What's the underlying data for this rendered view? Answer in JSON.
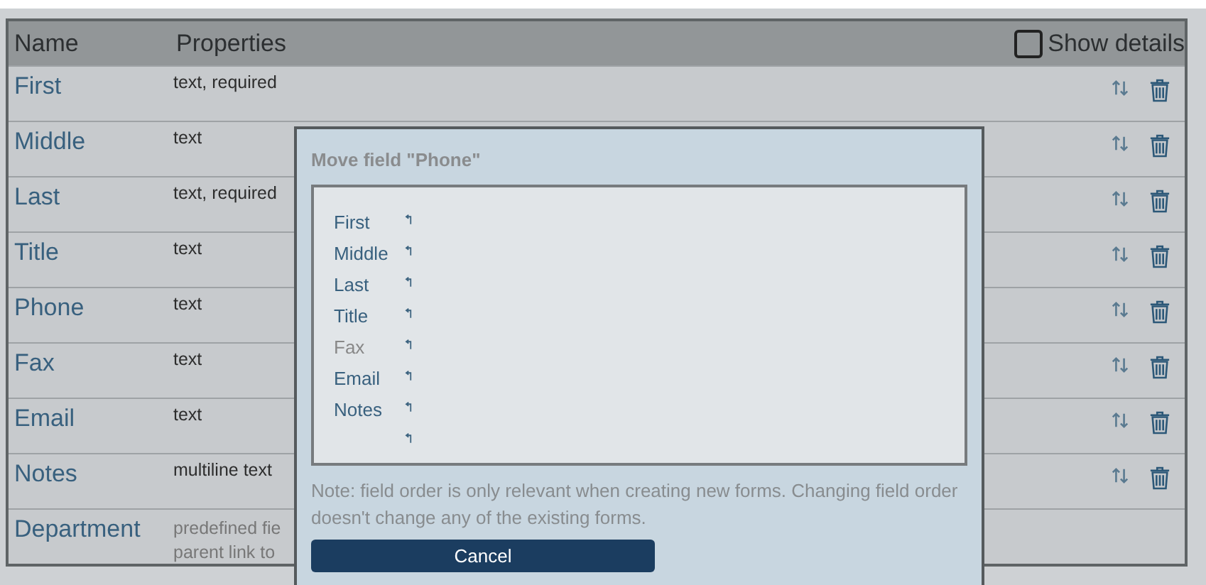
{
  "table": {
    "columns": [
      "Name",
      "Properties"
    ],
    "show_details": {
      "label": "Show details",
      "checked": false
    },
    "rows": [
      {
        "name": "First",
        "properties": [
          "text, required"
        ],
        "actions": true
      },
      {
        "name": "Middle",
        "properties": [
          "text"
        ],
        "actions": true
      },
      {
        "name": "Last",
        "properties": [
          "text, required"
        ],
        "actions": true
      },
      {
        "name": "Title",
        "properties": [
          "text"
        ],
        "actions": true
      },
      {
        "name": "Phone",
        "properties": [
          "text"
        ],
        "actions": true
      },
      {
        "name": "Fax",
        "properties": [
          "text"
        ],
        "actions": true
      },
      {
        "name": "Email",
        "properties": [
          "text"
        ],
        "actions": true
      },
      {
        "name": "Notes",
        "properties": [
          "multiline text"
        ],
        "actions": true
      },
      {
        "name": "Department",
        "properties": [
          "predefined fie",
          "parent link to"
        ],
        "actions": false
      }
    ]
  },
  "dialog": {
    "title": "Move field \"Phone\"",
    "targets": [
      {
        "name": "First",
        "disabled": false
      },
      {
        "name": "Middle",
        "disabled": false
      },
      {
        "name": "Last",
        "disabled": false
      },
      {
        "name": "Title",
        "disabled": false
      },
      {
        "name": "Fax",
        "disabled": true
      },
      {
        "name": "Email",
        "disabled": false
      },
      {
        "name": "Notes",
        "disabled": false
      }
    ],
    "end_slot": true,
    "note": "Note: field order is only relevant when creating new forms. Changing field order doesn't change any of the existing forms.",
    "button": "Cancel"
  }
}
